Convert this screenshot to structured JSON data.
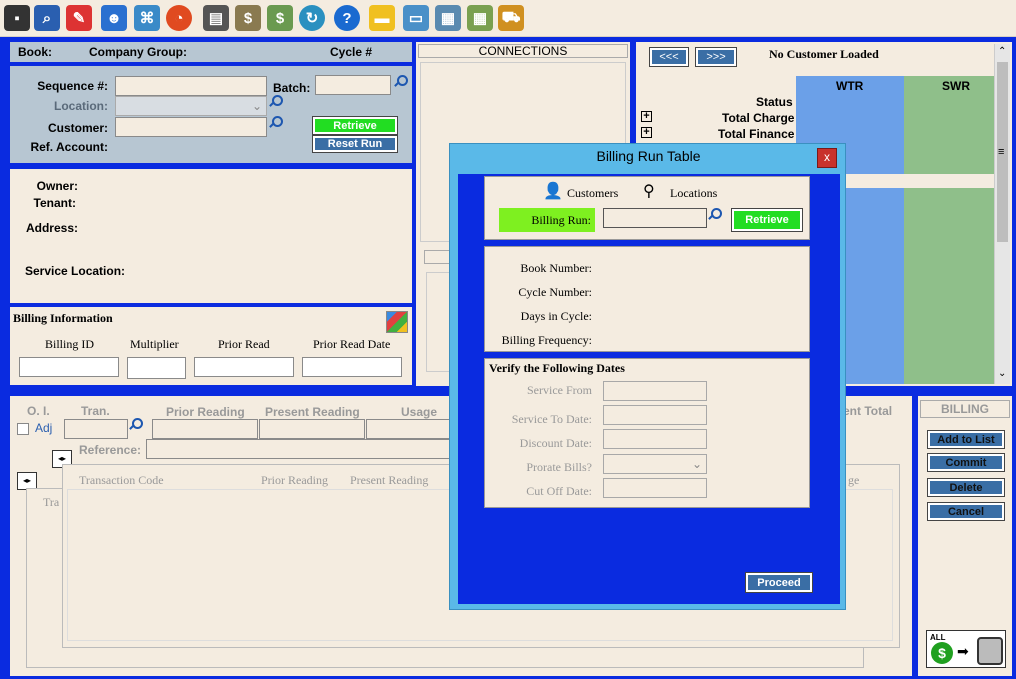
{
  "toolbar": {
    "icons": [
      "save-icon",
      "search-icon",
      "eraser-icon",
      "group-icon",
      "network-icon",
      "chart-icon",
      "document-icon",
      "money-bag-icon",
      "money-bag-green-icon",
      "refresh-icon",
      "help-icon",
      "folder-icon",
      "card-icon",
      "calendar-icon",
      "calendar-grid-icon",
      "truck-icon"
    ]
  },
  "header": {
    "book": "Book:",
    "company_group": "Company Group:",
    "cycle": "Cycle #"
  },
  "account": {
    "sequence_label": "Sequence #:",
    "batch_label": "Batch:",
    "location_label": "Location:",
    "customer_label": "Customer:",
    "ref_account_label": "Ref. Account:",
    "retrieve": "Retrieve",
    "reset_run": "Reset Run"
  },
  "owner": {
    "owner": "Owner:",
    "tenant": "Tenant:",
    "address": "Address:",
    "service_location": "Service Location:"
  },
  "billing_info": {
    "title": "Billing Information",
    "billing_id": "Billing ID",
    "multiplier": "Multiplier",
    "prior_read": "Prior Read",
    "prior_read_date": "Prior Read Date"
  },
  "connections": {
    "title": "CONNECTIONS"
  },
  "customer_panel": {
    "prev": "<<<",
    "next": ">>>",
    "status_text": "No Customer Loaded",
    "col_wtr": "WTR",
    "col_swr": "SWR",
    "rows": [
      "Status",
      "Total Charge",
      "Total Finance"
    ],
    "menu_glyph": "≡"
  },
  "transaction": {
    "oi": "O. I.",
    "adj": "Adj",
    "tran": "Tran.",
    "prior_reading": "Prior Reading",
    "present_reading": "Present Reading",
    "usage": "Usage",
    "present_total": "ent Total",
    "reference": "Reference:",
    "grid_headers": [
      "Transaction Code",
      "Prior Reading",
      "Present Reading"
    ],
    "grid_trailing": "ge",
    "back_header": "Tra"
  },
  "billing": {
    "title": "BILLING",
    "add_to_list": "Add to List",
    "commit": "Commit",
    "delete": "Delete",
    "cancel": "Cancel",
    "all_label": "ALL"
  },
  "dialog": {
    "title": "Billing Run Table",
    "close": "x",
    "customers": "Customers",
    "locations": "Locations",
    "billing_run_label": "Billing Run:",
    "retrieve": "Retrieve",
    "book_number": "Book Number:",
    "cycle_number": "Cycle Number:",
    "days_in_cycle": "Days in Cycle:",
    "billing_frequency": "Billing Frequency:",
    "verify_title": "Verify the Following Dates",
    "service_from": "Service From",
    "service_to": "Service To Date:",
    "discount_date": "Discount Date:",
    "prorate_bills": "Prorate Bills?",
    "cut_off_date": "Cut Off Date:",
    "proceed": "Proceed"
  }
}
